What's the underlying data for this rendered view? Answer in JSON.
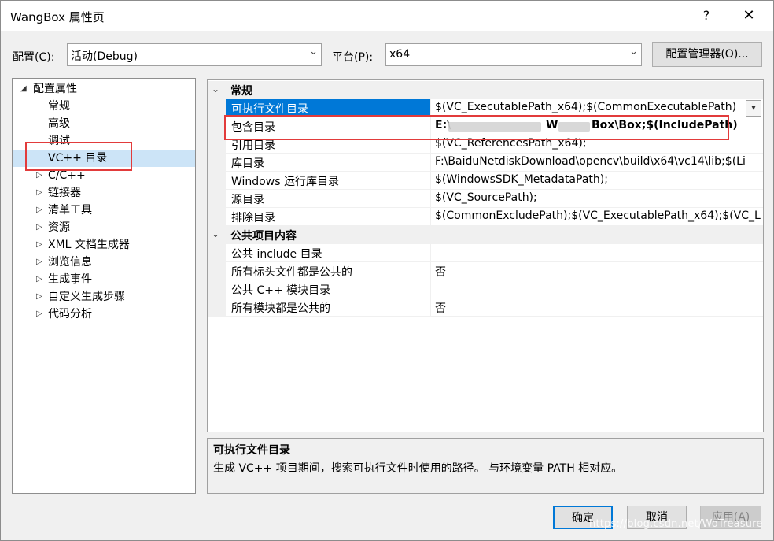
{
  "window": {
    "title": "WangBox 属性页",
    "help_label": "?",
    "close_label": "✕"
  },
  "toolbar": {
    "config_label": "配置(C):",
    "config_value": "活动(Debug)",
    "platform_label": "平台(P):",
    "platform_value": "x64",
    "config_manager_label": "配置管理器(O)..."
  },
  "tree": {
    "root": "配置属性",
    "items": [
      {
        "label": "常规",
        "expandable": false
      },
      {
        "label": "高级",
        "expandable": false
      },
      {
        "label": "调试",
        "expandable": false
      },
      {
        "label": "VC++ 目录",
        "expandable": false,
        "selected": true
      },
      {
        "label": "C/C++",
        "expandable": true
      },
      {
        "label": "链接器",
        "expandable": true
      },
      {
        "label": "清单工具",
        "expandable": true
      },
      {
        "label": "资源",
        "expandable": true
      },
      {
        "label": "XML 文档生成器",
        "expandable": true
      },
      {
        "label": "浏览信息",
        "expandable": true
      },
      {
        "label": "生成事件",
        "expandable": true
      },
      {
        "label": "自定义生成步骤",
        "expandable": true
      },
      {
        "label": "代码分析",
        "expandable": true
      }
    ]
  },
  "grid": {
    "categories": [
      {
        "label": "常规",
        "rows": [
          {
            "name": "可执行文件目录",
            "value": "$(VC_ExecutablePath_x64);$(CommonExecutablePath)",
            "selected": true
          },
          {
            "name": "包含目录",
            "value": "E:\\ ... \\W...Box\\Box;$(IncludePath)",
            "value_left": "E:\\",
            "value_mid": "W",
            "value_right": "Box\\Box;$(IncludePath)",
            "bold": true
          },
          {
            "name": "引用目录",
            "value": "$(VC_ReferencesPath_x64);"
          },
          {
            "name": "库目录",
            "value": "F:\\BaiduNetdiskDownload\\opencv\\build\\x64\\vc14\\lib;$(Li"
          },
          {
            "name": "Windows 运行库目录",
            "value": "$(WindowsSDK_MetadataPath);"
          },
          {
            "name": "源目录",
            "value": "$(VC_SourcePath);"
          },
          {
            "name": "排除目录",
            "value": "$(CommonExcludePath);$(VC_ExecutablePath_x64);$(VC_L"
          }
        ]
      },
      {
        "label": "公共项目内容",
        "rows": [
          {
            "name": "公共 include 目录",
            "value": ""
          },
          {
            "name": "所有标头文件都是公共的",
            "value": "否"
          },
          {
            "name": "公共 C++ 模块目录",
            "value": ""
          },
          {
            "name": "所有模块都是公共的",
            "value": "否"
          }
        ]
      }
    ]
  },
  "description": {
    "title": "可执行文件目录",
    "text": "生成 VC++ 项目期间，搜索可执行文件时使用的路径。 与环境变量 PATH 相对应。"
  },
  "buttons": {
    "ok": "确定",
    "cancel": "取消",
    "apply": "应用(A)"
  },
  "watermark": "https://blog.csdn.net/WoTreasure",
  "colors": {
    "selection": "#0078d7",
    "tree_selection": "#cce4f7",
    "highlight_box": "#e23b3b"
  }
}
